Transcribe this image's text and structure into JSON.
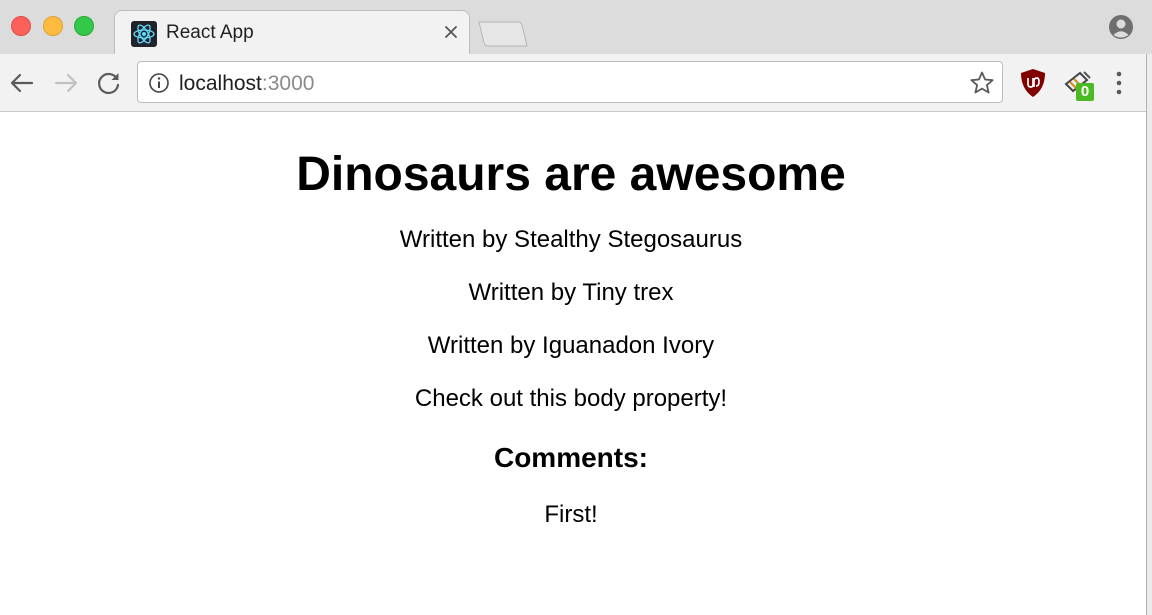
{
  "browser": {
    "tab": {
      "title": "React App",
      "favicon": "react-icon"
    },
    "address_bar": {
      "host": "localhost",
      "port": ":3000"
    },
    "extensions": {
      "second_badge": "0"
    }
  },
  "page": {
    "title": "Dinosaurs are awesome",
    "posts": [
      "Written by Stealthy Stegosaurus",
      "Written by Tiny trex",
      "Written by Iguanadon Ivory"
    ],
    "body": "Check out this body property!",
    "comments_heading": "Comments:",
    "comments": [
      "First!"
    ]
  },
  "colors": {
    "tab_strip": "#dcdcdc",
    "toolbar": "#f2f2f2",
    "close_light": "#fc605b",
    "minimize_light": "#fdbc40",
    "zoom_light": "#34c84a",
    "react_cyan": "#61dafb",
    "ublock_red": "#800000",
    "badge_green": "#4cba23"
  }
}
